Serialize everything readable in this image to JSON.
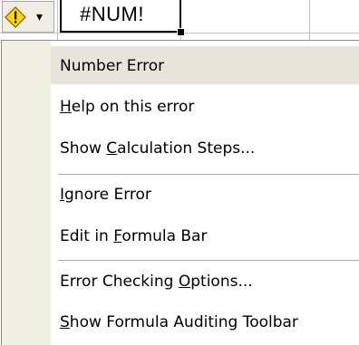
{
  "cell": {
    "value": "#NUM!"
  },
  "smart_tag": {
    "icon": "warning-diamond-icon",
    "dropdown_glyph": "▾"
  },
  "menu": {
    "header": "Number Error",
    "items": [
      {
        "label": "Help on this error",
        "accel_index": 0
      },
      {
        "label": "Show Calculation Steps...",
        "accel_index": 5
      },
      {
        "label": "Ignore Error",
        "accel_index": 0
      },
      {
        "label": "Edit in Formula Bar",
        "accel_index": 8
      },
      {
        "label": "Error Checking Options...",
        "accel_index": 15
      },
      {
        "label": "Show Formula Auditing Toolbar",
        "accel_index": 0
      }
    ]
  },
  "colors": {
    "menu_gutter": "#f1efe2",
    "menu_header": "#e7e5da",
    "warning_fill": "#ffd700",
    "grid": "#c0c0c0"
  }
}
